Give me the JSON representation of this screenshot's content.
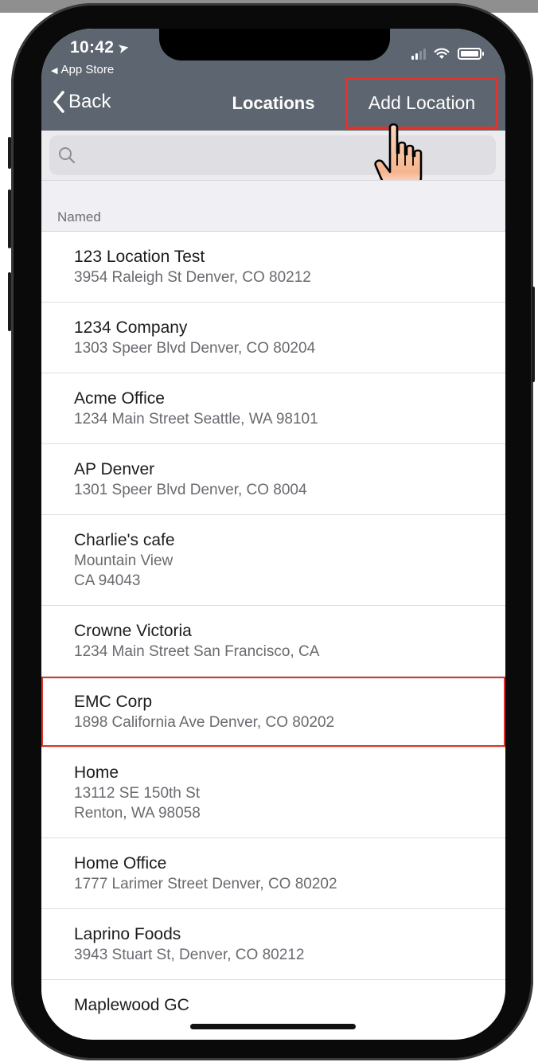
{
  "status_bar": {
    "time": "10:42",
    "back_app": "App Store"
  },
  "nav": {
    "back_label": "Back",
    "title": "Locations",
    "add_label": "Add Location"
  },
  "search": {
    "placeholder": ""
  },
  "section": {
    "header": "Named"
  },
  "locations": [
    {
      "name": "123 Location Test",
      "address": "3954 Raleigh St Denver, CO 80212"
    },
    {
      "name": "1234 Company",
      "address": "1303 Speer Blvd Denver, CO 80204"
    },
    {
      "name": "Acme Office",
      "address": "1234 Main Street Seattle, WA 98101"
    },
    {
      "name": "AP Denver",
      "address": "1301 Speer Blvd Denver, CO 8004"
    },
    {
      "name": "Charlie's cafe",
      "address_lines": [
        "Mountain View",
        "CA 94043"
      ]
    },
    {
      "name": "Crowne Victoria",
      "address": "1234 Main Street San Francisco, CA"
    },
    {
      "name": "EMC Corp",
      "address": "1898 California Ave Denver, CO 80202",
      "highlighted": true
    },
    {
      "name": "Home",
      "address_lines": [
        "13112 SE 150th St",
        "Renton, WA 98058"
      ]
    },
    {
      "name": "Home Office",
      "address": "1777 Larimer Street Denver, CO 80202"
    },
    {
      "name": "Laprino Foods",
      "address": "3943 Stuart St, Denver, CO  80212"
    },
    {
      "name": "Maplewood GC",
      "address": ""
    }
  ],
  "colors": {
    "nav_background": "#5d6670",
    "highlight_border": "#e0332d",
    "list_background": "#ffffff",
    "section_background": "#efeff4"
  },
  "icons": {
    "back": "chevron-left-icon",
    "search": "magnifying-glass-icon",
    "location_arrow": "location-arrow-icon",
    "wifi": "wifi-icon",
    "battery": "battery-icon",
    "cursor": "hand-pointer-icon"
  }
}
